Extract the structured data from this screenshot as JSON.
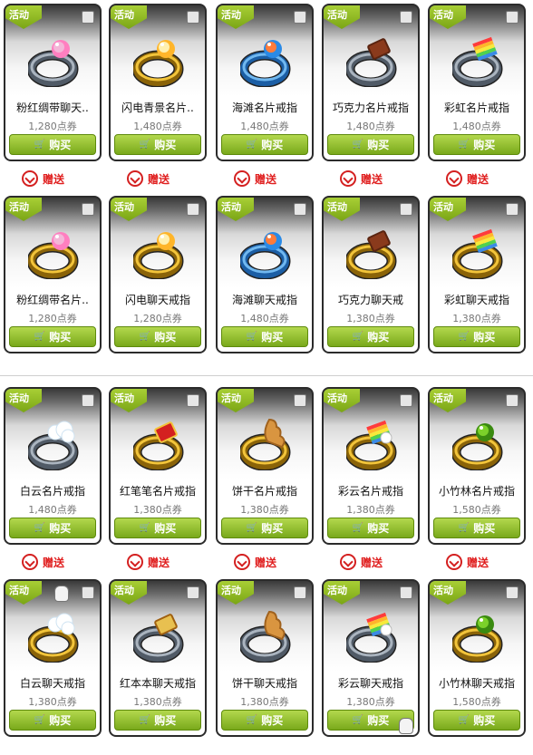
{
  "tag_label": "活动",
  "buy_label": "购买",
  "gift_label": "赠送",
  "sections": [
    {
      "rows": [
        [
          {
            "name": "粉红绸带聊天..",
            "price": "1,280点券",
            "ring": "gem-pink-silver"
          },
          {
            "name": "闪电青景名片..",
            "price": "1,480点券",
            "ring": "gem-gold"
          },
          {
            "name": "海滩名片戒指",
            "price": "1,480点券",
            "ring": "gem-blue-silver"
          },
          {
            "name": "巧克力名片戒指",
            "price": "1,480点券",
            "ring": "chocolate-silver"
          },
          {
            "name": "彩虹名片戒指",
            "price": "1,480点券",
            "ring": "rainbow-silver"
          }
        ],
        [
          {
            "name": "粉红绸带名片..",
            "price": "1,280点券",
            "ring": "gem-pink-gold"
          },
          {
            "name": "闪电聊天戒指",
            "price": "1,280点券",
            "ring": "gem-gold"
          },
          {
            "name": "海滩聊天戒指",
            "price": "1,480点券",
            "ring": "gem-blue-silver"
          },
          {
            "name": "巧克力聊天戒",
            "price": "1,380点券",
            "ring": "chocolate-gold"
          },
          {
            "name": "彩虹聊天戒指",
            "price": "1,380点券",
            "ring": "rainbow-gold"
          }
        ]
      ]
    },
    {
      "rows": [
        [
          {
            "name": "白云名片戒指",
            "price": "1,480点券",
            "ring": "cloud-silver"
          },
          {
            "name": "红笔笔名片戒指",
            "price": "1,380点券",
            "ring": "book-gold"
          },
          {
            "name": "饼干名片戒指",
            "price": "1,380点券",
            "ring": "cookie-gold"
          },
          {
            "name": "彩云名片戒指",
            "price": "1,380点券",
            "ring": "rainbowcloud-gold"
          },
          {
            "name": "小竹林名片戒指",
            "price": "1,580点券",
            "ring": "green-gold"
          }
        ],
        [
          {
            "name": "白云聊天戒指",
            "price": "1,380点券",
            "ring": "cloud-gold"
          },
          {
            "name": "红本本聊天戒指",
            "price": "1,380点券",
            "ring": "notebook-silver"
          },
          {
            "name": "饼干聊天戒指",
            "price": "1,380点券",
            "ring": "cookie-silver"
          },
          {
            "name": "彩云聊天戒指",
            "price": "1,380点券",
            "ring": "rainbowcloud-silver"
          },
          {
            "name": "小竹林聊天戒指",
            "price": "1,580点券",
            "ring": "green-gold"
          }
        ]
      ]
    }
  ],
  "colors": {
    "accent_green": "#8cbc22",
    "gift_red": "#e02020",
    "price_gray": "#777777"
  }
}
